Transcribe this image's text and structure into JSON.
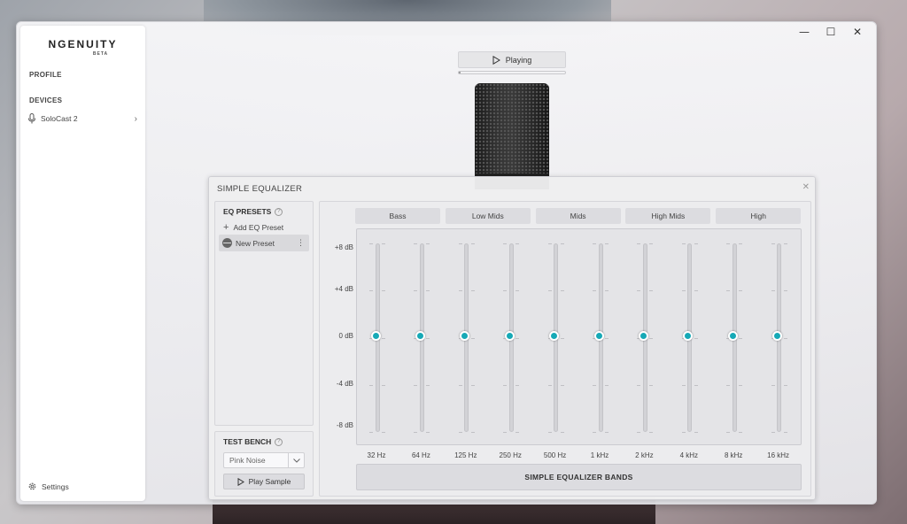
{
  "window": {
    "controls": {
      "minimize": "—",
      "maximize": "☐",
      "close": "✕"
    }
  },
  "sidebar": {
    "brand": "NGENUITY",
    "brand_sub": "BETA",
    "profile_label": "PROFILE",
    "devices_label": "DEVICES",
    "device_name": "SoloCast 2",
    "settings_label": "Settings"
  },
  "player": {
    "status": "Playing",
    "progress": 0.02
  },
  "equalizer": {
    "title": "SIMPLE EQUALIZER",
    "presets_heading": "EQ PRESETS",
    "add_preset_label": "Add EQ Preset",
    "preset_name": "New Preset",
    "test_bench_heading": "TEST BENCH",
    "test_bench_select": "Pink Noise",
    "play_sample_label": "Play Sample",
    "band_groups": [
      "Bass",
      "Low Mids",
      "Mids",
      "High Mids",
      "High"
    ],
    "db_scale": [
      "+8 dB",
      "+4 dB",
      "0 dB",
      "-4 dB",
      "-8 dB"
    ],
    "gain_range": [
      -8,
      8
    ],
    "bands": [
      {
        "freq": "32 Hz",
        "gain": 0
      },
      {
        "freq": "64 Hz",
        "gain": 0
      },
      {
        "freq": "125 Hz",
        "gain": 0
      },
      {
        "freq": "250 Hz",
        "gain": 0
      },
      {
        "freq": "500 Hz",
        "gain": 0
      },
      {
        "freq": "1 kHz",
        "gain": 0
      },
      {
        "freq": "2 kHz",
        "gain": 0
      },
      {
        "freq": "4 kHz",
        "gain": 0
      },
      {
        "freq": "8 kHz",
        "gain": 0
      },
      {
        "freq": "16 kHz",
        "gain": 0
      }
    ],
    "bands_button_label": "SIMPLE EQUALIZER BANDS",
    "accent_color": "#16a9b6"
  }
}
